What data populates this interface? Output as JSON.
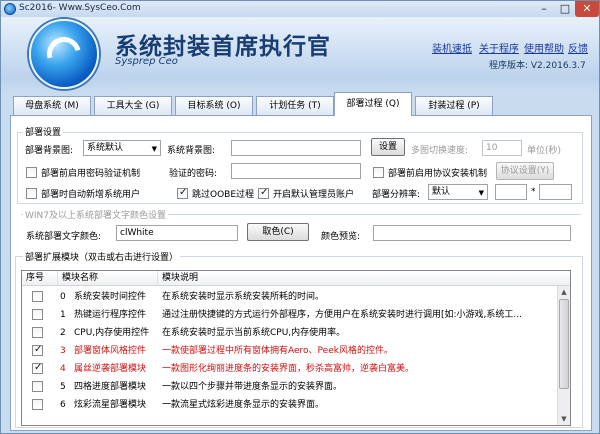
{
  "window": {
    "title": "Sc2016- Www.SysCeo.Com",
    "minimize": "–",
    "maximize": "□",
    "close": "✕"
  },
  "header": {
    "title": "系统封装首席执行官",
    "subtitle": "Sysprep Ceo",
    "links": [
      "装机速抵",
      "关于程序",
      "使用帮助",
      "反馈"
    ],
    "version": "程序版本: V2.2016.3.7"
  },
  "tabs": [
    {
      "label": "母盘系统 (M)"
    },
    {
      "label": "工具大全 (G)"
    },
    {
      "label": "目标系统 (O)"
    },
    {
      "label": "计划任务 (T)"
    },
    {
      "label": "部署过程 (Q)"
    },
    {
      "label": "封装过程 (P)"
    }
  ],
  "deploy": {
    "group_title": "部署设置",
    "bg_label": "部署背景图:",
    "bg_value": "系统默认",
    "sys_bg_label": "系统背景图:",
    "sys_bg_value": "",
    "setup_btn": "设置",
    "speed_label": "多图切换速度:",
    "speed_value": "10",
    "speed_unit": "单位(秒)",
    "cb_password_label": "部署前启用密码验证机制",
    "verify_label": "验证的密码:",
    "verify_value": "",
    "cb_protocol_label": "部署前启用协议安装机制",
    "protocol_btn": "协议设置(Y)",
    "cb_newuser_label": "部署时自动新增系统用户",
    "cb_oobe_label": "跳过OOBE过程",
    "cb_admin_label": "开启默认管理员账户",
    "res_label": "部署分辨率:",
    "res_value": "默认",
    "res_w": "",
    "res_x": "*",
    "res_h": ""
  },
  "textcolor": {
    "section": "WIN7及以上系统部署文字颜色设置",
    "label": "系统部署文字颜色:",
    "value": "clWhite",
    "pick_btn": "取色(C)",
    "preview_label": "颜色预览:"
  },
  "modules": {
    "title": "部署扩展模块（双击或右击进行设置）",
    "headers": [
      "序号",
      "模块名称",
      "模块说明"
    ],
    "rows": [
      {
        "idx": "0",
        "name": "系统安装时间控件",
        "desc": "在系统安装时显示系统安装所耗的时间。",
        "checked": false,
        "red": false
      },
      {
        "idx": "1",
        "name": "热键运行程序控件",
        "desc": "通过注册快捷键的方式运行外部程序，方便用户在系统安装时进行调用[如:小游戏,系统工...",
        "checked": false,
        "red": false
      },
      {
        "idx": "2",
        "name": "CPU,内存使用控件",
        "desc": "在系统安装时显示当前系统CPU,内存使用率。",
        "checked": false,
        "red": false
      },
      {
        "idx": "3",
        "name": "部署窗体风格控件",
        "desc": "一款使部署过程中所有窗体拥有Aero、Peek风格的控件。",
        "checked": true,
        "red": true
      },
      {
        "idx": "4",
        "name": "属丝逆袭部署模块",
        "desc": "一款图形化绚丽进度条的安装界面，秒杀高富帅，逆袭白富美。",
        "checked": true,
        "red": true
      },
      {
        "idx": "5",
        "name": "四格进度部署模块",
        "desc": "一款以四个步骤并带进度条显示的安装界面。",
        "checked": false,
        "red": false
      },
      {
        "idx": "6",
        "name": "炫彩流星部署模块",
        "desc": "一款流星式炫彩进度条显示的安装界面。",
        "checked": false,
        "red": false
      }
    ]
  },
  "colors": {
    "red": "#d01010",
    "title": "#1a3d74",
    "link": "#1a3a9a"
  }
}
